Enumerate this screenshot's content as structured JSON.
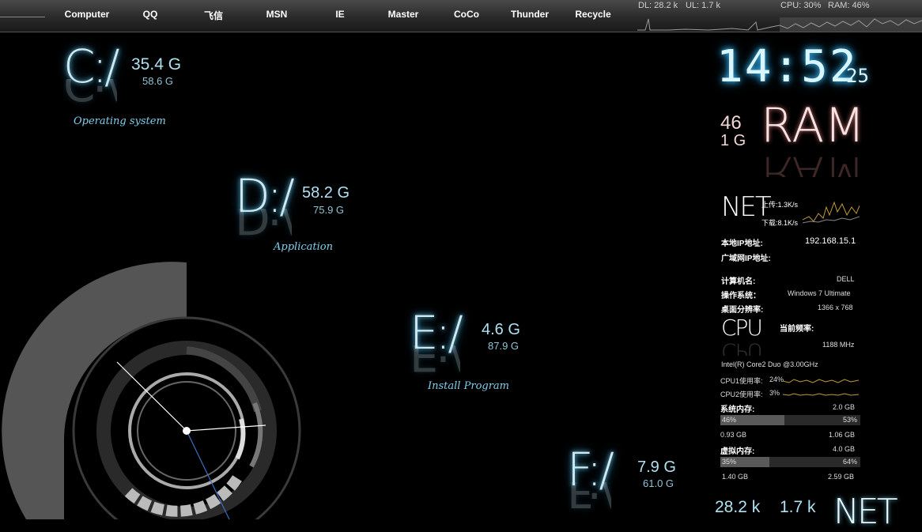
{
  "taskbar": {
    "items": [
      {
        "label": "Computer"
      },
      {
        "label": "QQ"
      },
      {
        "label": "飞信"
      },
      {
        "label": "MSN"
      },
      {
        "label": "IE"
      },
      {
        "label": "Master"
      },
      {
        "label": "CoCo"
      },
      {
        "label": "Thunder"
      },
      {
        "label": "Recycle"
      }
    ],
    "dl": "DL: 28.2 k",
    "ul": "UL: 1.7 k",
    "cpu": "CPU: 30%",
    "ram": "RAM: 46%"
  },
  "drives": {
    "c": {
      "letter": "C:/",
      "free": "35.4 G",
      "total": "58.6 G",
      "label": "Operating system"
    },
    "d": {
      "letter": "D:/",
      "free": "58.2 G",
      "total": "75.9 G",
      "label": "Application"
    },
    "e": {
      "letter": "E:/",
      "free": "4.6 G",
      "total": "87.9 G",
      "label": "Install Program"
    },
    "f": {
      "letter": "F:/",
      "free": "7.9 G",
      "total": "61.0 G"
    }
  },
  "clock": {
    "time": "14:52",
    "seconds": "25"
  },
  "ram": {
    "label": "RAM",
    "percent": "46",
    "total": "1 G"
  },
  "net": {
    "label": "NET",
    "upload": "上传:1.3K/s",
    "download": "下载:8.1K/s",
    "local_ip_label": "本地IP地址:",
    "local_ip": "192.168.15.1",
    "wan_ip_label": "广域网IP地址:"
  },
  "system": {
    "computer_name_label": "计算机名:",
    "computer_name": "DELL",
    "os_label": "操作系统：",
    "os": "Windows 7 Ultimate",
    "resolution_label": "桌面分辨率:",
    "resolution": "1366 x 768"
  },
  "cpu": {
    "label": "CPU",
    "freq_label": "当前频率:",
    "freq": "1188 MHz",
    "model": "Intel(R) Core2 Duo @3.00GHz",
    "cpu1_label": "CPU1使用率:",
    "cpu1": "24%",
    "cpu2_label": "CPU2使用率:",
    "cpu2": "3%"
  },
  "memory": {
    "label": "系统内存:",
    "total": "2.0 GB",
    "used_pct": "46%",
    "free_pct": "53%",
    "used_fraction": 0.46,
    "used": "0.93 GB",
    "free": "1.06 GB"
  },
  "virtual": {
    "label": "虚拟内存:",
    "total": "4.0 GB",
    "used_pct": "35%",
    "free_pct": "64%",
    "used_fraction": 0.35,
    "used": "1.40 GB",
    "free": "2.59 GB"
  },
  "bottom": {
    "dl": "28.2 k",
    "ul": "1.7 k",
    "net": "NET"
  }
}
